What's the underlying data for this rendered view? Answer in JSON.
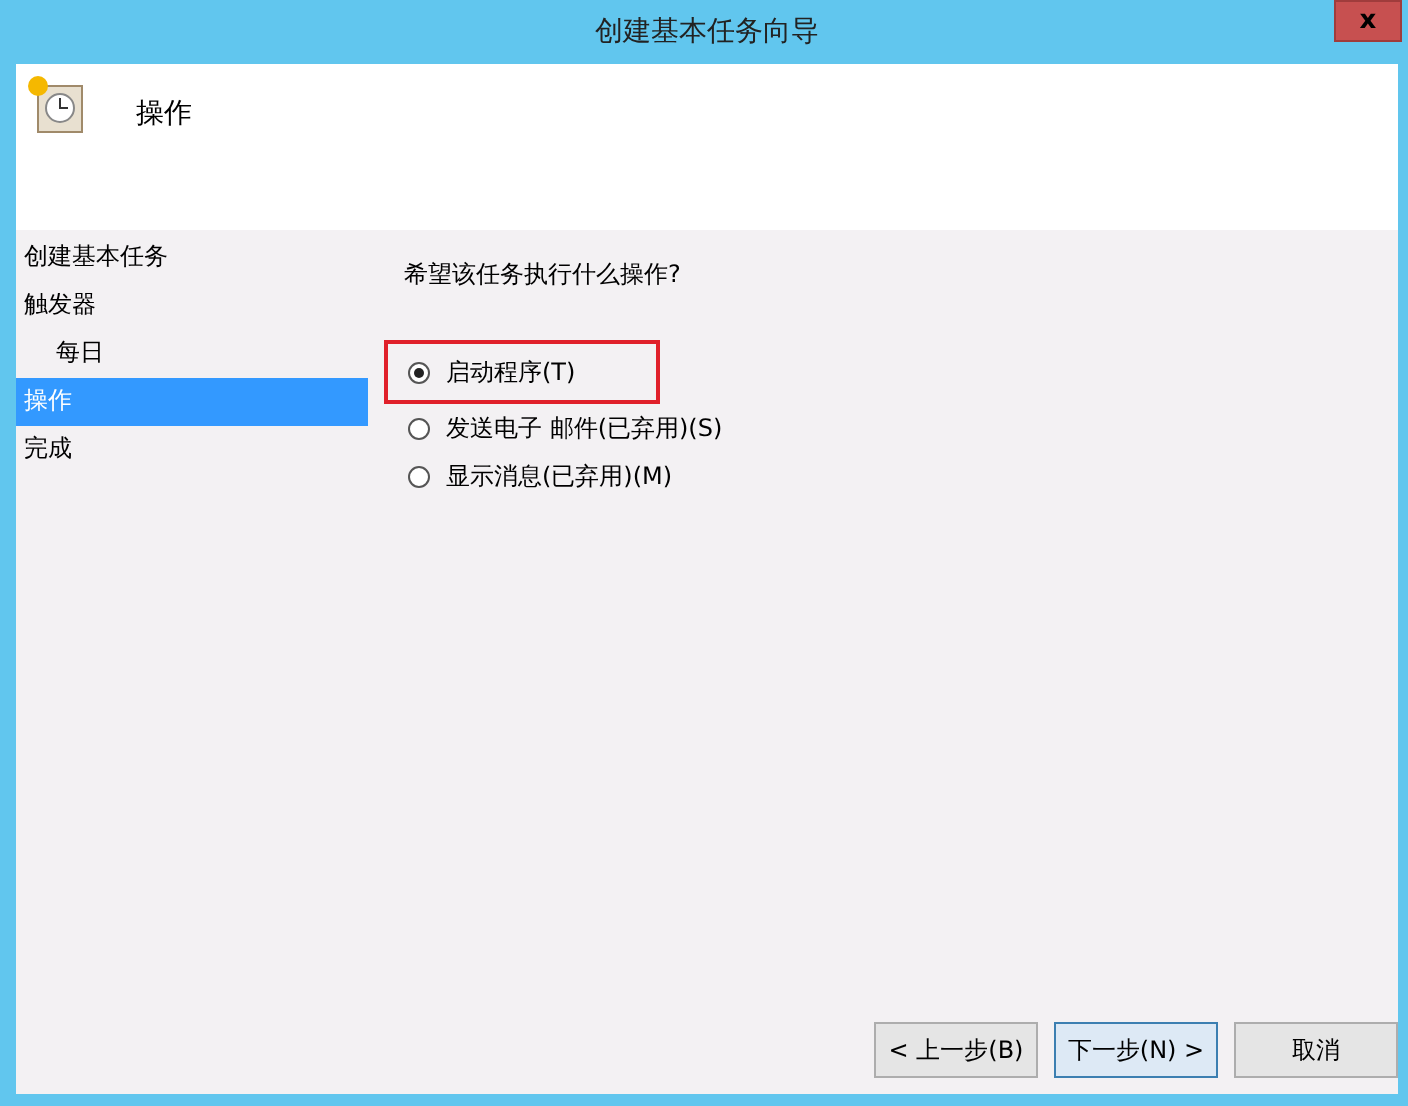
{
  "window": {
    "title": "创建基本任务向导",
    "close": "x"
  },
  "header": {
    "title": "操作"
  },
  "sidebar": {
    "items": [
      {
        "label": "创建基本任务",
        "selected": false
      },
      {
        "label": "触发器",
        "selected": false,
        "children": [
          {
            "label": "每日",
            "selected": false
          }
        ]
      },
      {
        "label": "操作",
        "selected": true
      },
      {
        "label": "完成",
        "selected": false
      }
    ]
  },
  "question": "希望该任务执行什么操作?",
  "options": [
    {
      "label": "启动程序(T)",
      "selected": true,
      "highlighted": true
    },
    {
      "label": "发送电子 邮件(已弃用)(S)",
      "selected": false,
      "highlighted": false
    },
    {
      "label": "显示消息(已弃用)(M)",
      "selected": false,
      "highlighted": false
    }
  ],
  "buttons": [
    {
      "label": "< 上一步(B)",
      "default": false
    },
    {
      "label": "下一步(N) >",
      "default": true
    },
    {
      "label": "取消",
      "default": false
    }
  ]
}
